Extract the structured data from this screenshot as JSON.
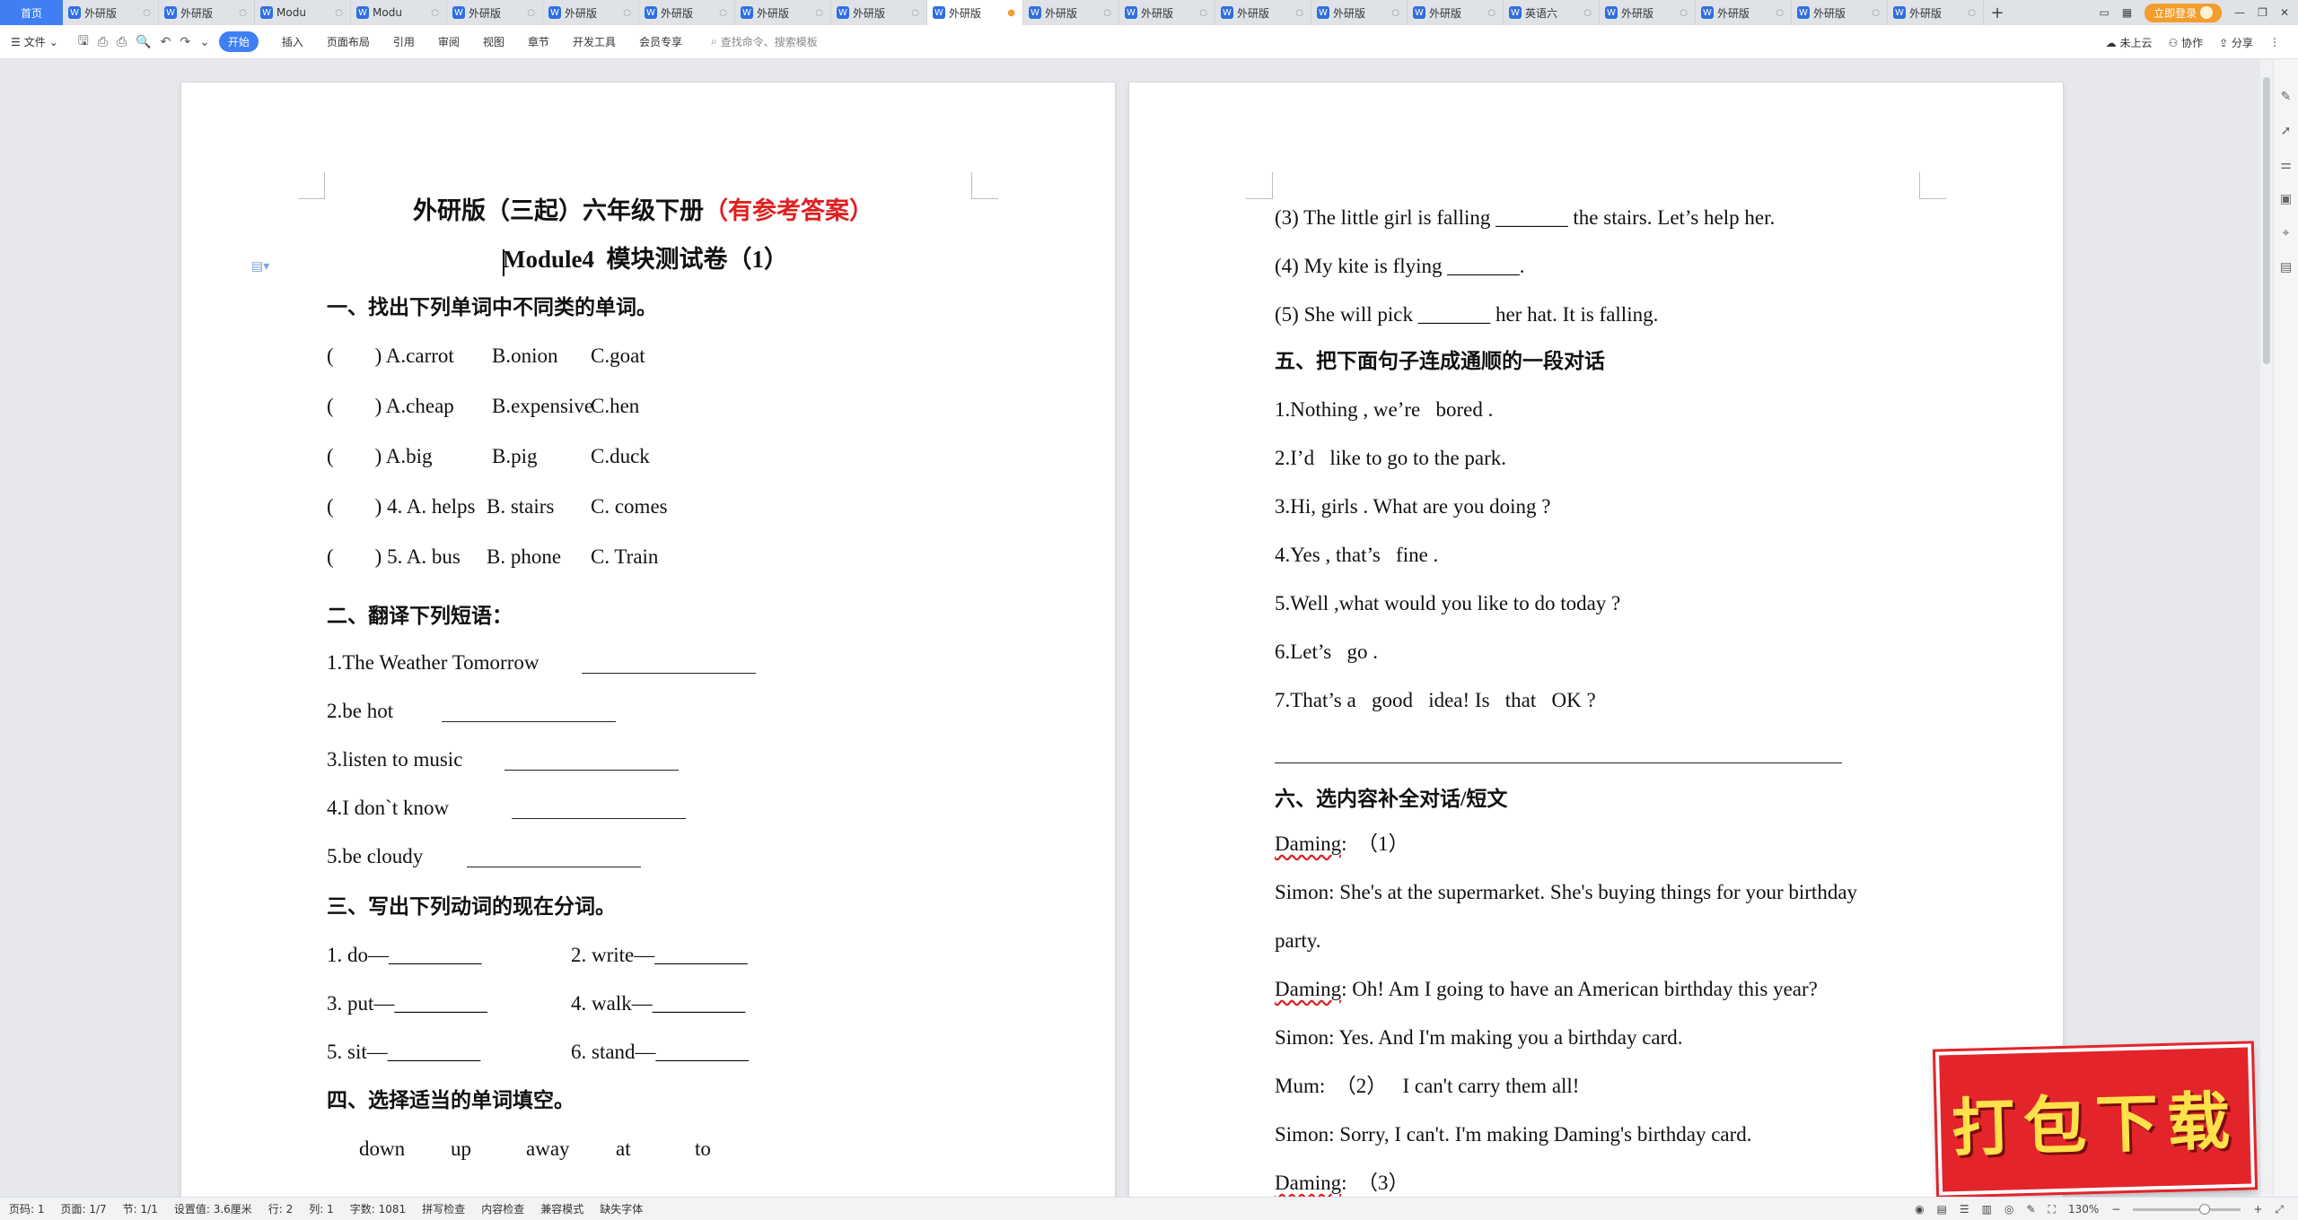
{
  "tabbar": {
    "home": "首页",
    "tabs": [
      {
        "label": "外研版",
        "active": false
      },
      {
        "label": "外研版",
        "active": false
      },
      {
        "label": "Modu",
        "active": false
      },
      {
        "label": "Modu",
        "active": false
      },
      {
        "label": "外研版",
        "active": false
      },
      {
        "label": "外研版",
        "active": false
      },
      {
        "label": "外研版",
        "active": false
      },
      {
        "label": "外研版",
        "active": false
      },
      {
        "label": "外研版",
        "active": false
      },
      {
        "label": "外研版",
        "active": true
      },
      {
        "label": "外研版",
        "active": false
      },
      {
        "label": "外研版",
        "active": false
      },
      {
        "label": "外研版",
        "active": false
      },
      {
        "label": "外研版",
        "active": false
      },
      {
        "label": "外研版",
        "active": false
      },
      {
        "label": "英语六",
        "active": false
      },
      {
        "label": "外研版",
        "active": false
      },
      {
        "label": "外研版",
        "active": false
      },
      {
        "label": "外研版",
        "active": false
      },
      {
        "label": "外研版",
        "active": false
      }
    ],
    "new_tab": "+",
    "login": "立即登录"
  },
  "ribbon": {
    "file": "文件",
    "tabs": [
      "开始",
      "插入",
      "页面布局",
      "引用",
      "审阅",
      "视图",
      "章节",
      "开发工具",
      "会员专享"
    ],
    "active_tab": "开始",
    "search": "查找命令、搜索模板",
    "right": [
      "未上云",
      "协作",
      "分享"
    ]
  },
  "left_page": {
    "title_black": "外研版（三起）六年级下册",
    "title_red": "（有参考答案）",
    "subtitle": "Module4  模块测试卷（1）",
    "s1": "一、找出下列单词中不同类的单词。",
    "q1": [
      [
        "(        ) A.carrot",
        "B.onion",
        "C.goat"
      ],
      [
        "(        ) A.cheap",
        "B.expensive",
        "C.hen"
      ],
      [
        "(        ) A.big",
        "B.pig",
        "C.duck"
      ],
      [
        "(        ) 4. A. helps",
        "B. stairs",
        "C. comes"
      ],
      [
        "(        ) 5. A. bus",
        "B. phone",
        "C. Train"
      ]
    ],
    "s2": "二、翻译下列短语：",
    "q2": [
      "1.The Weather Tomorrow",
      "2.be hot",
      "3.listen to music",
      "4.I don`t know",
      "5.be cloudy"
    ],
    "s3": "三、写出下列动词的现在分词。",
    "q3": [
      [
        "1. do—_________",
        "2. write—_________"
      ],
      [
        "3. put—_________",
        "4. walk—_________"
      ],
      [
        "5. sit—_________",
        "6. stand—_________"
      ]
    ],
    "s4": "四、选择适当的单词填空。",
    "words": [
      "down",
      "up",
      "away",
      "at",
      "to"
    ]
  },
  "right_page": {
    "lines_top": [
      "(3) The little girl is falling _______ the stairs. Let’s help her.",
      "(4) My kite is flying _______.",
      "(5) She will pick _______ her hat. It is falling."
    ],
    "s5": "五、把下面句子连成通顺的一段对话",
    "q5": [
      "1.Nothing , we’re   bored .",
      "2.I’d   like to go to the park.",
      "3.Hi, girls . What are you doing ?",
      "4.Yes , that’s   fine .",
      "5.Well ,what would you like to do today ?",
      "6.Let’s   go .",
      "7.That’s a   good   idea! Is   that   OK ?"
    ],
    "s6": "六、选内容补全对话/短文",
    "dialog": [
      {
        "speaker": "Daming",
        "text": ":  （1）"
      },
      {
        "speaker": "Simon",
        "text": ": She's at the supermarket. She's buying things for your birthday"
      },
      {
        "speaker": "",
        "text": "party."
      },
      {
        "speaker": "Daming",
        "text": ": Oh! Am I going to have an American birthday this year?"
      },
      {
        "speaker": "Simon",
        "text": ": Yes. And I'm making you a birthday card."
      },
      {
        "speaker": "Mum",
        "text": ":  （2）   I can't carry them all!"
      },
      {
        "speaker": "Simon",
        "text": ": Sorry, I can't. I'm making Daming's birthday card."
      },
      {
        "speaker": "Daming",
        "text": ":  （3）"
      }
    ]
  },
  "statusbar": {
    "items": [
      "页码: 1",
      "页面: 1/7",
      "节: 1/1",
      "设置值: 3.6厘米",
      "行: 2",
      "列: 1",
      "字数: 1081",
      "拼写检查",
      "内容检查",
      "兼容模式",
      "缺失字体"
    ],
    "zoom": "130%"
  },
  "promo": "打包下载",
  "colors": {
    "accent": "#3f7ff3",
    "red": "#e02020",
    "orange": "#f29d2c",
    "promo_bg": "#e3242b",
    "promo_text": "#ffe14a"
  }
}
